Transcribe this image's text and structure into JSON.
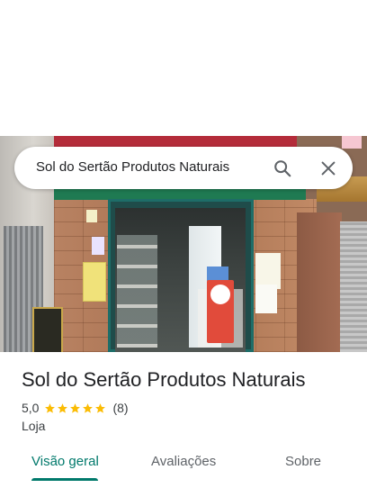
{
  "search": {
    "query": "Sol do Sertão Produtos Naturais",
    "search_icon": "search-icon",
    "close_icon": "close-icon"
  },
  "place": {
    "name": "Sol do Sertão Produtos Naturais",
    "rating": "5,0",
    "stars": 5,
    "review_count": "(8)",
    "category": "Loja"
  },
  "tabs": [
    {
      "label": "Visão geral",
      "active": true
    },
    {
      "label": "Avaliações",
      "active": false
    },
    {
      "label": "Sobre",
      "active": false
    }
  ],
  "colors": {
    "accent": "#00796b",
    "star": "#fbbc04",
    "text_primary": "#202124",
    "text_secondary": "#3c4043"
  }
}
